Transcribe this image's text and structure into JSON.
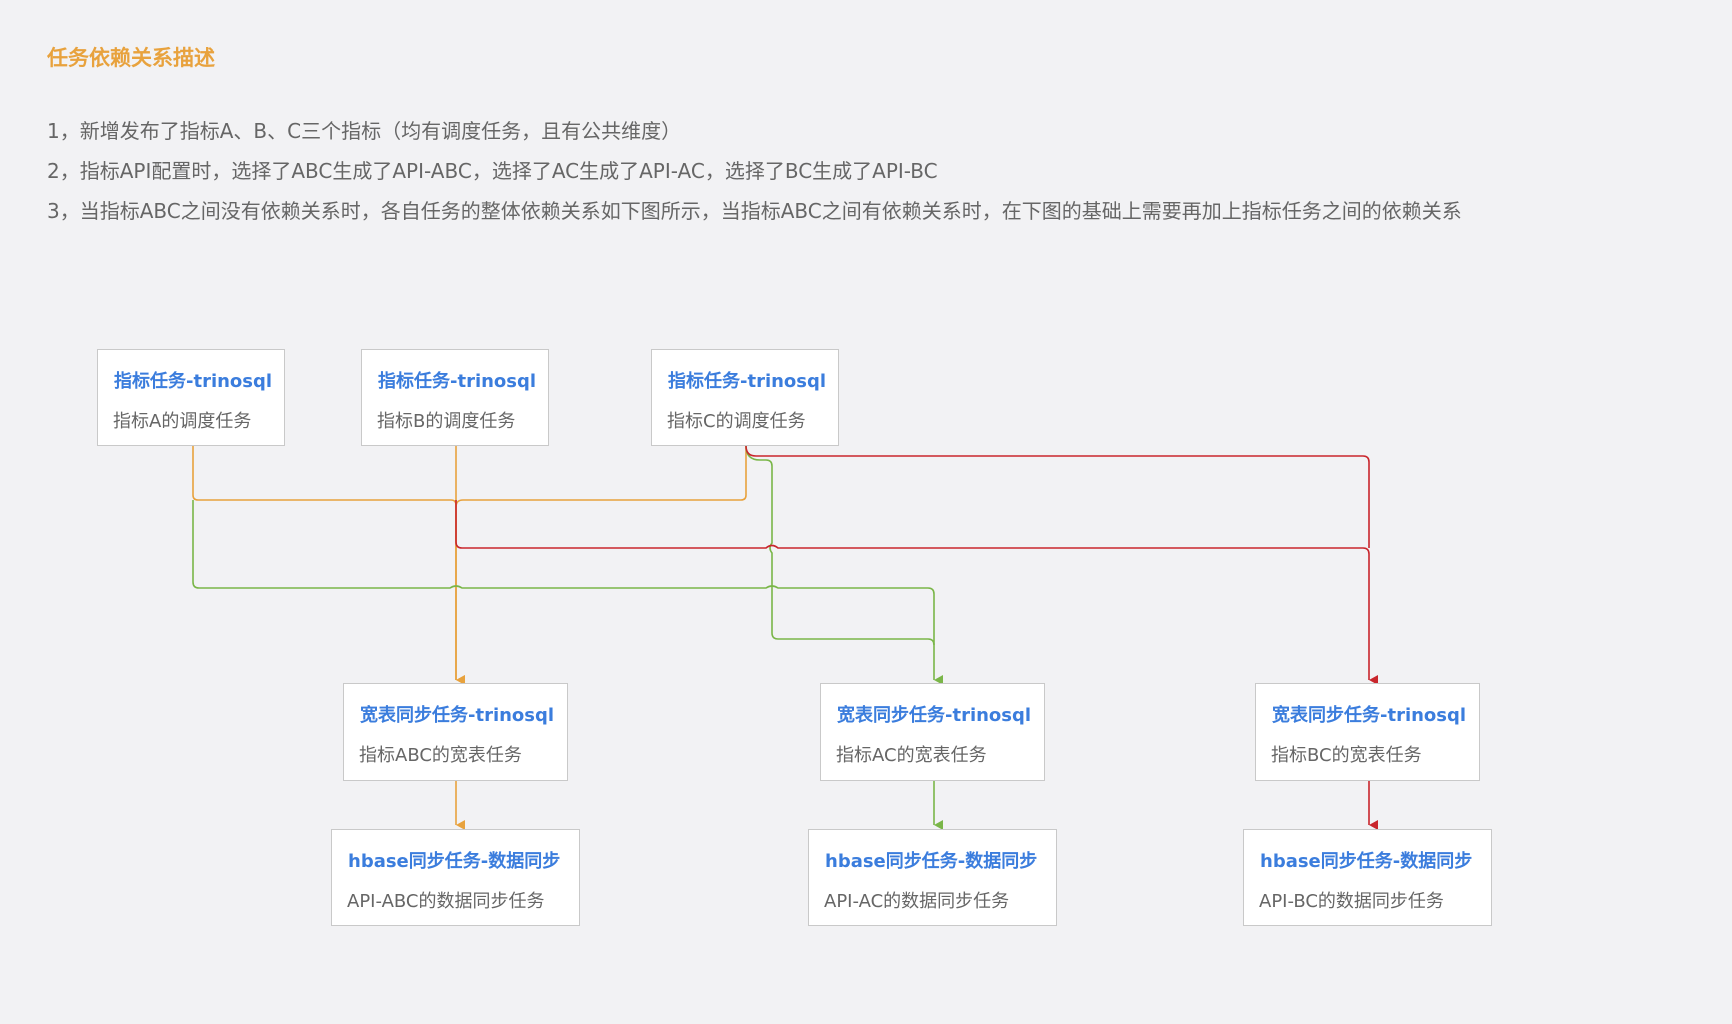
{
  "header": {
    "title": "任务依赖关系描述",
    "lines": [
      "1，新增发布了指标A、B、C三个指标（均有调度任务，且有公共维度）",
      "2，指标API配置时，选择了ABC生成了API-ABC，选择了AC生成了API-AC，选择了BC生成了API-BC",
      "3，当指标ABC之间没有依赖关系时，各自任务的整体依赖关系如下图所示，当指标ABC之间有依赖关系时，在下图的基础上需要再加上指标任务之间的依赖关系"
    ]
  },
  "colors": {
    "orange": "#e8a23d",
    "green": "#7ab648",
    "red": "#c9262c",
    "node_title": "#3b7ddd",
    "node_text": "#666666"
  },
  "diagram": {
    "metric_tasks": [
      {
        "title": "指标任务-trinosql",
        "subtitle": "指标A的调度任务"
      },
      {
        "title": "指标任务-trinosql",
        "subtitle": "指标B的调度任务"
      },
      {
        "title": "指标任务-trinosql",
        "subtitle": "指标C的调度任务"
      }
    ],
    "wide_table_tasks": [
      {
        "title": "宽表同步任务-trinosql",
        "subtitle": "指标ABC的宽表任务"
      },
      {
        "title": "宽表同步任务-trinosql",
        "subtitle": "指标AC的宽表任务"
      },
      {
        "title": "宽表同步任务-trinosql",
        "subtitle": "指标BC的宽表任务"
      }
    ],
    "hbase_tasks": [
      {
        "title": "hbase同步任务-数据同步",
        "subtitle": "API-ABC的数据同步任务"
      },
      {
        "title": "hbase同步任务-数据同步",
        "subtitle": "API-AC的数据同步任务"
      },
      {
        "title": "hbase同步任务-数据同步",
        "subtitle": "API-BC的数据同步任务"
      }
    ],
    "edges": [
      {
        "from": "指标A的调度任务",
        "to": "指标ABC的宽表任务",
        "color": "orange"
      },
      {
        "from": "指标B的调度任务",
        "to": "指标ABC的宽表任务",
        "color": "orange"
      },
      {
        "from": "指标C的调度任务",
        "to": "指标ABC的宽表任务",
        "color": "orange"
      },
      {
        "from": "指标A的调度任务",
        "to": "指标AC的宽表任务",
        "color": "green"
      },
      {
        "from": "指标C的调度任务",
        "to": "指标AC的宽表任务",
        "color": "green"
      },
      {
        "from": "指标B的调度任务",
        "to": "指标BC的宽表任务",
        "color": "red"
      },
      {
        "from": "指标C的调度任务",
        "to": "指标BC的宽表任务",
        "color": "red"
      },
      {
        "from": "指标ABC的宽表任务",
        "to": "API-ABC的数据同步任务",
        "color": "orange"
      },
      {
        "from": "指标AC的宽表任务",
        "to": "API-AC的数据同步任务",
        "color": "green"
      },
      {
        "from": "指标BC的宽表任务",
        "to": "API-BC的数据同步任务",
        "color": "red"
      }
    ]
  }
}
